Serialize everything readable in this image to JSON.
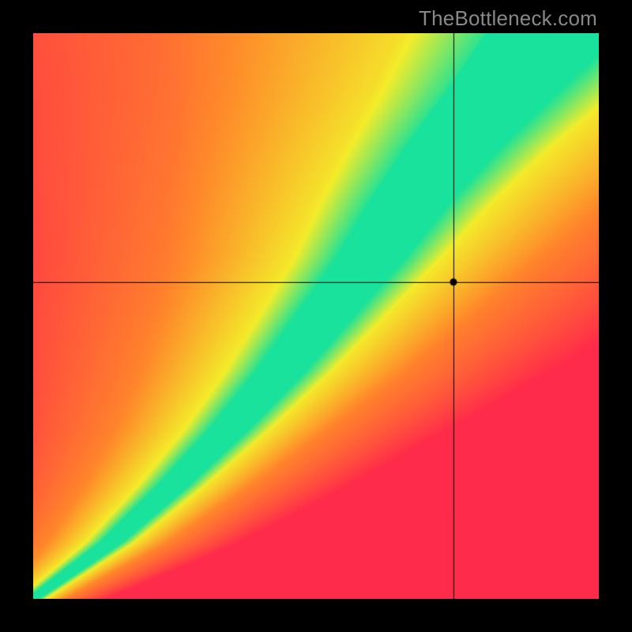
{
  "watermark": "TheBottleneck.com",
  "colors": {
    "red": "#ff2b4a",
    "orange": "#ff8a2a",
    "yellow": "#f4ed2a",
    "green": "#18e29b",
    "crosshair": "#000000"
  },
  "chart_data": {
    "type": "heatmap",
    "title": "",
    "xlabel": "",
    "ylabel": "",
    "xlim": [
      0,
      1
    ],
    "ylim": [
      0,
      1
    ],
    "description": "2-D compatibility heatmap. Green ridge marks near-ideal pairing along a roughly super-linear diagonal; yellow = mild mismatch; orange/red = heavy bottleneck.",
    "ridge_center_x_at_y": [
      [
        0.0,
        0.0
      ],
      [
        0.1,
        0.14
      ],
      [
        0.2,
        0.25
      ],
      [
        0.3,
        0.35
      ],
      [
        0.4,
        0.44
      ],
      [
        0.5,
        0.52
      ],
      [
        0.6,
        0.6
      ],
      [
        0.7,
        0.67
      ],
      [
        0.8,
        0.75
      ],
      [
        0.9,
        0.84
      ],
      [
        1.0,
        0.93
      ]
    ],
    "ridge_halfwidth_at_y": [
      [
        0.0,
        0.01
      ],
      [
        0.1,
        0.018
      ],
      [
        0.2,
        0.025
      ],
      [
        0.3,
        0.032
      ],
      [
        0.4,
        0.04
      ],
      [
        0.5,
        0.048
      ],
      [
        0.6,
        0.056
      ],
      [
        0.7,
        0.066
      ],
      [
        0.8,
        0.078
      ],
      [
        0.9,
        0.092
      ],
      [
        1.0,
        0.11
      ]
    ],
    "marker_point": {
      "x": 0.743,
      "y": 0.56
    },
    "crosshair": {
      "x": 0.743,
      "y": 0.56
    },
    "color_stops_by_match_quality": [
      {
        "q": 1.0,
        "color": "green"
      },
      {
        "q": 0.55,
        "color": "yellow"
      },
      {
        "q": 0.3,
        "color": "orange"
      },
      {
        "q": 0.0,
        "color": "red"
      }
    ]
  }
}
